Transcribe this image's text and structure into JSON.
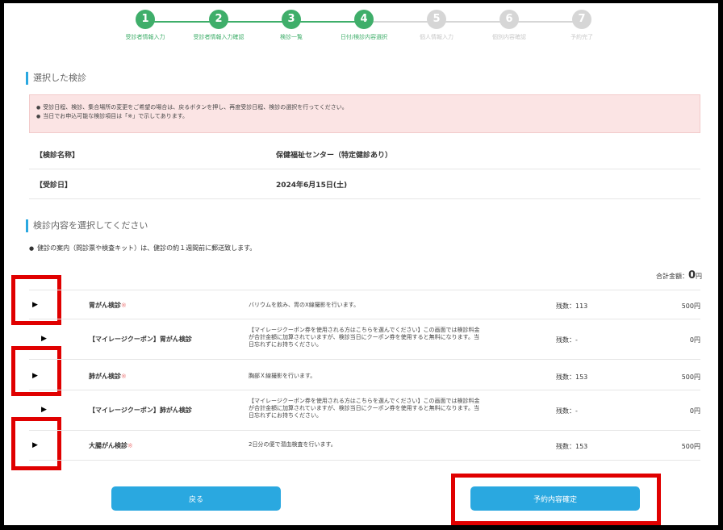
{
  "stepper": {
    "steps": [
      {
        "num": "1",
        "label": "受診者情報入力",
        "state": "done"
      },
      {
        "num": "2",
        "label": "受診者情報入力確認",
        "state": "done"
      },
      {
        "num": "3",
        "label": "検診一覧",
        "state": "done"
      },
      {
        "num": "4",
        "label": "日付/検診内容選択",
        "state": "current"
      },
      {
        "num": "5",
        "label": "個人情報入力",
        "state": "todo"
      },
      {
        "num": "6",
        "label": "個別内容確認",
        "state": "todo"
      },
      {
        "num": "7",
        "label": "予約完了",
        "state": "todo"
      }
    ],
    "colors": {
      "active": "#3fae6a",
      "inactive": "#d6d6d6"
    }
  },
  "selected": {
    "title": "選択した検診",
    "notices": [
      "受診日程、検診、集合場所の変更をご希望の場合は、戻るボタンを押し、再度受診日程、検診の選択を行ってください。",
      "当日でお申込可能な検診項目は「※」で示してあります。"
    ],
    "rows": [
      {
        "key": "【検診名称】",
        "value": "保健福祉センター（特定健診あり）"
      },
      {
        "key": "【受診日】",
        "value": "2024年6月15日(土)"
      }
    ]
  },
  "content": {
    "title": "検診内容を選択してください",
    "note": "健診の案内（問診票や検査キット）は、健診の約１週間前に郵送致します。",
    "total_label": "合計金額：",
    "total_value": "0",
    "total_unit": "円",
    "items": [
      {
        "arrow": "▶",
        "name": "胃がん検診",
        "mark": "※",
        "desc": "バリウムを飲み、胃のX線撮影を行います。",
        "remain": "残数：113",
        "price": "500円"
      },
      {
        "arrow": "▶",
        "name": "【マイレージクーポン】胃がん検診",
        "mark": "",
        "desc": "【マイレージクーポン券を使用される方はこちらを選んでください】この画面では検診料金が合計金額に加算されていますが、検診当日にクーポン券を使用すると無料になります。当日忘れずにお持ちください。",
        "remain": "残数：-",
        "price": "0円"
      },
      {
        "arrow": "▶",
        "name": "肺がん検診",
        "mark": "※",
        "desc": "胸部Ｘ線撮影を行います。",
        "remain": "残数：153",
        "price": "500円"
      },
      {
        "arrow": "▶",
        "name": "【マイレージクーポン】肺がん検診",
        "mark": "",
        "desc": "【マイレージクーポン券を使用される方はこちらを選んでください】この画面では検診料金が合計金額に加算されていますが、検診当日にクーポン券を使用すると無料になります。当日忘れずにお持ちください。",
        "remain": "残数：-",
        "price": "0円"
      },
      {
        "arrow": "▶",
        "name": "大腸がん検診",
        "mark": "※",
        "desc": "2日分の便で潜血検査を行います。",
        "remain": "残数：153",
        "price": "500円"
      }
    ]
  },
  "buttons": {
    "back": "戻る",
    "confirm": "予約内容確定"
  },
  "highlight_color": "#e00000"
}
